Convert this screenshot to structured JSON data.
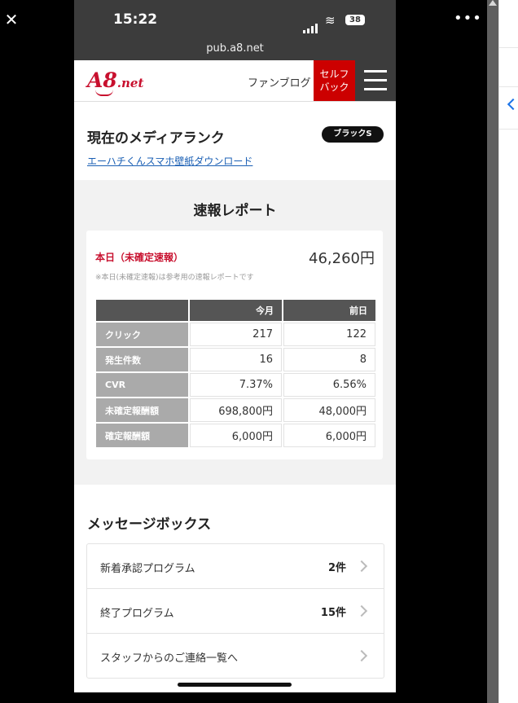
{
  "status": {
    "time": "15:22",
    "battery": "38"
  },
  "browser": {
    "url": "pub.a8.net"
  },
  "header": {
    "logo_main": "A8",
    "logo_sub": ".net",
    "fan_blog": "ファンブログ",
    "self_back_line1": "セルフ",
    "self_back_line2": "バック"
  },
  "rank": {
    "title": "現在のメディアランク",
    "badge": "ブラックS",
    "wallpaper_link": "エーハチくんスマホ壁紙ダウンロード"
  },
  "report": {
    "title": "速報レポート",
    "today_label": "本日（未確定速報）",
    "today_amount": "46,260円",
    "note": "※本日(未確定速報)は参考用の速報レポートです",
    "columns": [
      "今月",
      "前日"
    ],
    "rows": [
      {
        "label": "クリック",
        "this_month": "217",
        "prev_day": "122"
      },
      {
        "label": "発生件数",
        "this_month": "16",
        "prev_day": "8"
      },
      {
        "label": "CVR",
        "this_month": "7.37%",
        "prev_day": "6.56%"
      },
      {
        "label": "未確定報酬額",
        "this_month": "698,800円",
        "prev_day": "48,000円"
      },
      {
        "label": "確定報酬額",
        "this_month": "6,000円",
        "prev_day": "6,000円"
      }
    ]
  },
  "messages": {
    "title": "メッセージボックス",
    "items": [
      {
        "label": "新着承認プログラム",
        "count": "2件"
      },
      {
        "label": "終了プログラム",
        "count": "15件"
      },
      {
        "label": "スタッフからのご連絡一覧へ",
        "count": ""
      }
    ]
  }
}
